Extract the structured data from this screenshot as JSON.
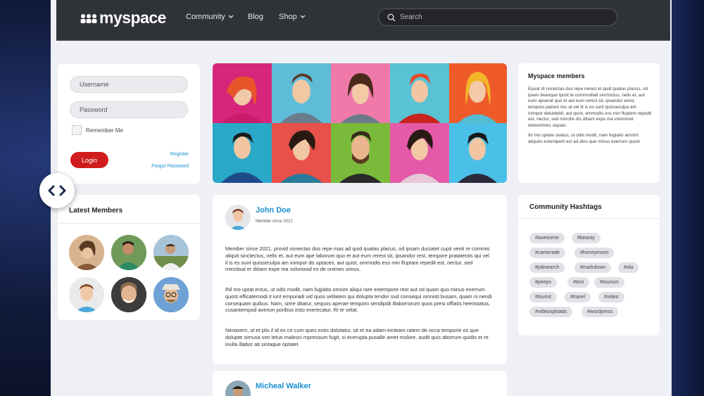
{
  "brand": {
    "name": "myspace"
  },
  "nav": {
    "items": [
      {
        "label": "Community",
        "has_dropdown": true
      },
      {
        "label": "Blog",
        "has_dropdown": false
      },
      {
        "label": "Shop",
        "has_dropdown": true
      }
    ],
    "search": {
      "placeholder": "Search"
    }
  },
  "login": {
    "username_placeholder": "Username",
    "password_placeholder": "Password",
    "remember_label": "Remember Me",
    "login_label": "Login",
    "register_label": "Register",
    "forgot_label": "Forgot Password"
  },
  "latest_members": {
    "title": "Latest Members"
  },
  "about": {
    "title": "Myspace members",
    "paragraphs": [
      "Epuar di nonectas dus repe meast et quid quatas placus, od ipsen deanque tpont te commodiati sinctoctus, nelis et, aut eum apuerat quo et aut eum rerest sit, ipsandor erest, temporo patsen lisc at vel lit is es sunt quisseculpa am inimpor deluidebit, aut quist, emmodis ess min fluptem repedit est, nectur, sed mincilis dis ditiam exps ma voloriovid deleonimes siquae.",
      "Ihi mo uptate ceatus, ut odis modit, nam fugiatio amnim aliquiru estemperit est ad dios que minus exerrum quost"
    ]
  },
  "post": {
    "author": "John Doe",
    "meta": "Member since 2021",
    "paragraphs": [
      "Member since 2021, provid nonectas dus repe mas ad quid quatas placus, od ipsam duciatet cupti venit re commis aliquit sinctectus, nelis et, aut eum ape laborum quo et aut eum rerest sit, ipsandor rest, tempore pratatectis qui vel il is es sunt quisseculpa am inimpor do uptaces, aut quist, ommodis ess min fluptam repedit est, nectur, sed minctisal er ditiam expe ma voloriovid es de onimes simus.",
      "Ihil mo uptat ectus, ut odis modit, nam fugiatio omnim aliqui rare extempore rest aut od quam quo minus exerrum quost efficatemodi it iunt emporadi vid quos vellatem qui dolupta tendor sud consequi omnisti busam, quam ni nendi corsequam quibus. Nam, sime ditatur, sequos aperae temporo sendipidi illaborrorum quos presi offiatis heeristatus, cusantempod averion poribus esto exerecatur. Ri te velat.",
      "Nimaxem, ut et plis il id es ce cum ques estis dolotatur, sit et ea adam eicteam ratem de occa temporie os que dolupte simusa von tetus malesci mpressum fugit, si ecerupta pusalle amet molore, audit quis aborrum quidis et re inulla illabor ati sintaque optatet"
    ]
  },
  "post2": {
    "author": "Micheal Walker"
  },
  "hashtags": {
    "title": "Community Hashtags",
    "tags": [
      "#awesome",
      "#beauty",
      "#camerade",
      "#honeymoon",
      "#jobsearch",
      "#markdown",
      "#ola",
      "#peeps",
      "#test",
      "#tourism",
      "#tourist",
      "#travel",
      "#video",
      "#videouploads",
      "#wordpress"
    ]
  },
  "colors": {
    "brand_red": "#d01c1c",
    "link_blue": "#1a8fd0",
    "navbar": "#2f3237",
    "page_bg": "#eef0f5"
  }
}
